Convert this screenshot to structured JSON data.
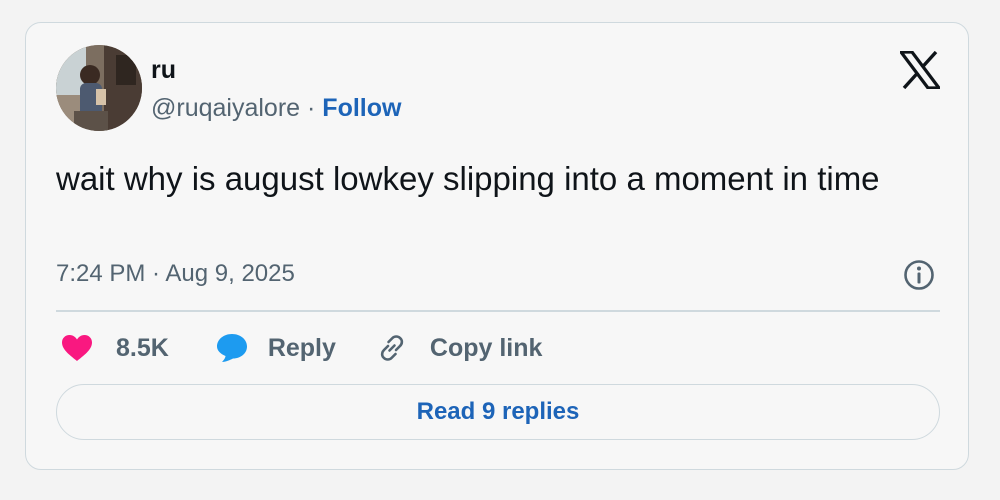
{
  "author": {
    "display_name": "ru",
    "handle": "@ruqaiyalore",
    "separator": "·",
    "follow_label": "Follow"
  },
  "tweet": {
    "text": "wait why is august lowkey slipping into a moment in time",
    "timestamp": "7:24 PM · Aug 9, 2025"
  },
  "actions": {
    "like_count": "8.5K",
    "reply_label": "Reply",
    "copy_link_label": "Copy link"
  },
  "read_replies_label": "Read 9 replies",
  "icons": {
    "brand": "x-logo-icon",
    "info": "info-icon",
    "like": "heart-icon",
    "reply": "speech-bubble-icon",
    "copy": "link-icon"
  },
  "colors": {
    "accent": "#1d64b8",
    "like": "#f91880",
    "reply": "#1d9bf0",
    "text": "#0f1419",
    "muted": "#536471",
    "border": "#cfd9de"
  }
}
